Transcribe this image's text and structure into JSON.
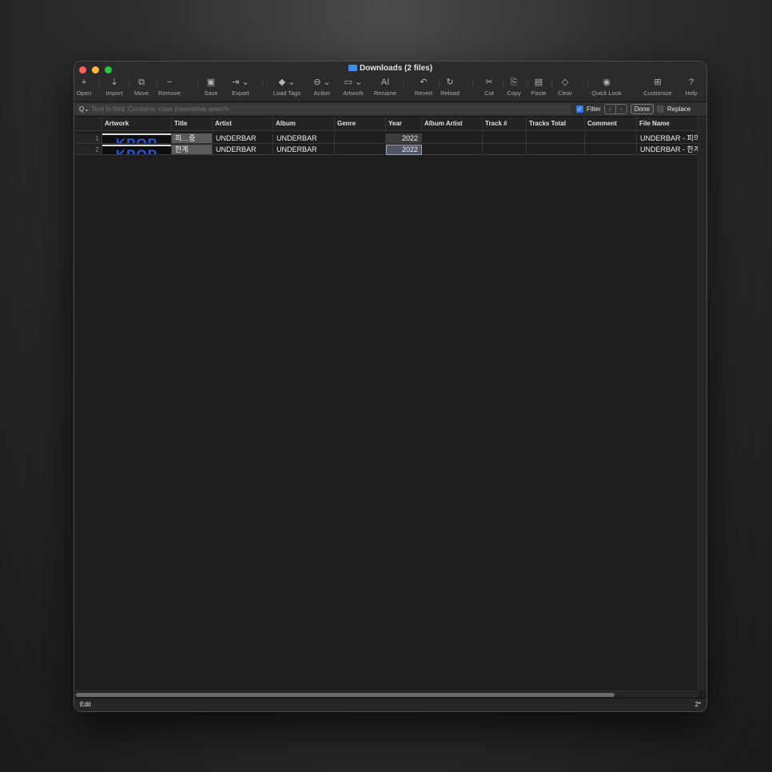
{
  "window": {
    "title": "Downloads (2 files)"
  },
  "toolbar": [
    {
      "label": "Open",
      "icon": "+",
      "name": "open"
    },
    {
      "label": "Import",
      "icon": "⇣",
      "name": "import"
    },
    {
      "label": "Move",
      "icon": "⧉",
      "name": "move"
    },
    {
      "label": "Remove",
      "icon": "−",
      "name": "remove"
    },
    {
      "label": "Save",
      "icon": "▣",
      "name": "save"
    },
    {
      "label": "Export",
      "icon": "⇥ ⌄",
      "name": "export"
    },
    {
      "label": "Load Tags",
      "icon": "◆ ⌄",
      "name": "load-tags"
    },
    {
      "label": "Action",
      "icon": "⊖ ⌄",
      "name": "action"
    },
    {
      "label": "Artwork",
      "icon": "▭ ⌄",
      "name": "artwork"
    },
    {
      "label": "Rename",
      "icon": "AI",
      "name": "rename"
    },
    {
      "label": "Revert",
      "icon": "↶",
      "name": "revert"
    },
    {
      "label": "Reload",
      "icon": "↻",
      "name": "reload"
    },
    {
      "label": "Cut",
      "icon": "✂",
      "name": "cut"
    },
    {
      "label": "Copy",
      "icon": "⎘",
      "name": "copy"
    },
    {
      "label": "Paste",
      "icon": "▤",
      "name": "paste"
    },
    {
      "label": "Clear",
      "icon": "◇",
      "name": "clear"
    },
    {
      "label": "Quick Look",
      "icon": "◉",
      "name": "quick-look"
    },
    {
      "label": "Customize",
      "icon": "⊞",
      "name": "customize"
    },
    {
      "label": "Help",
      "icon": "?",
      "name": "help"
    }
  ],
  "search": {
    "placeholder": "Text to find. Contains, case insensitive search.",
    "filter_label": "Filter",
    "filter_checked": true,
    "done_label": "Done",
    "replace_label": "Replace",
    "replace_checked": false
  },
  "table": {
    "columns": [
      "Artwork",
      "Title",
      "Artist",
      "Album",
      "Genre",
      "Year",
      "Album Artist",
      "Track #",
      "Tracks Total",
      "Comment",
      "File Name"
    ],
    "rows": [
      {
        "num": "1",
        "artwork": "KPOP",
        "title": "피…중",
        "artist": "UNDERBAR",
        "album": "UNDERBAR",
        "genre": "",
        "year": "2022",
        "album_artist": "",
        "track": "",
        "tracks_total": "",
        "comment": "",
        "file_name": "UNDERBAR - 피의"
      },
      {
        "num": "2",
        "artwork": "KPOP",
        "title": "한계",
        "artist": "UNDERBAR",
        "album": "UNDERBAR",
        "genre": "",
        "year": "2022",
        "album_artist": "",
        "track": "",
        "tracks_total": "",
        "comment": "",
        "file_name": "UNDERBAR - 한계"
      }
    ]
  },
  "status": {
    "left": "Edit",
    "right": "2*"
  }
}
